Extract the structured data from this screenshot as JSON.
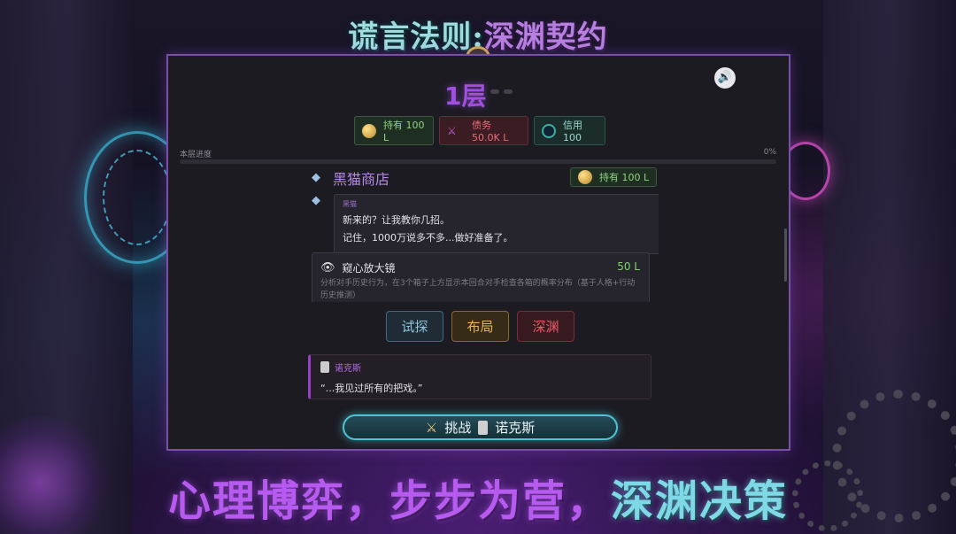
{
  "game_title": {
    "part1": "谎言法则",
    "separator": ":",
    "part2": "深渊契约"
  },
  "floor": {
    "label": "1层"
  },
  "stats": {
    "hold": {
      "label": "持有 100 L"
    },
    "debt": {
      "label": "债务 50.0K L"
    },
    "credit": {
      "label": "信用 100"
    }
  },
  "progress": {
    "label": "本层进度",
    "percent_text": "0%",
    "value": 0
  },
  "shop": {
    "title": "黑猫商店",
    "hold_label": "持有 100 L",
    "npc": {
      "name": "黑猫",
      "lines": [
        "新来的？让我教你几招。",
        "记住，1000万说多不多...做好准备了。"
      ]
    },
    "item": {
      "name": "窥心放大镜",
      "price": "50 L",
      "description": "分析对手历史行为，在3个箱子上方显示本回合对手检查各箱的概率分布（基于人格+行动历史推测）"
    }
  },
  "actions": {
    "probe": "试探",
    "layout": "布局",
    "abyss": "深渊"
  },
  "opponent": {
    "name": "诺克斯",
    "quote": "“...我见过所有的把戏。”"
  },
  "challenge": {
    "prefix": "挑战",
    "opponent": "诺克斯"
  },
  "slogan": {
    "part1": "心理博弈，步步为营，",
    "part2": "深渊决策"
  },
  "colors": {
    "accent_purple": "#a14fe0",
    "teal": "#4cc4d6",
    "gold": "#e5b45a",
    "red": "#ea5a66",
    "green": "#8fd47d"
  },
  "icons": [
    "speaker-icon",
    "coin-icon",
    "dagger-icon",
    "credit-icon",
    "cat-icon",
    "eye-icon",
    "swords-icon",
    "opponent-icon"
  ]
}
